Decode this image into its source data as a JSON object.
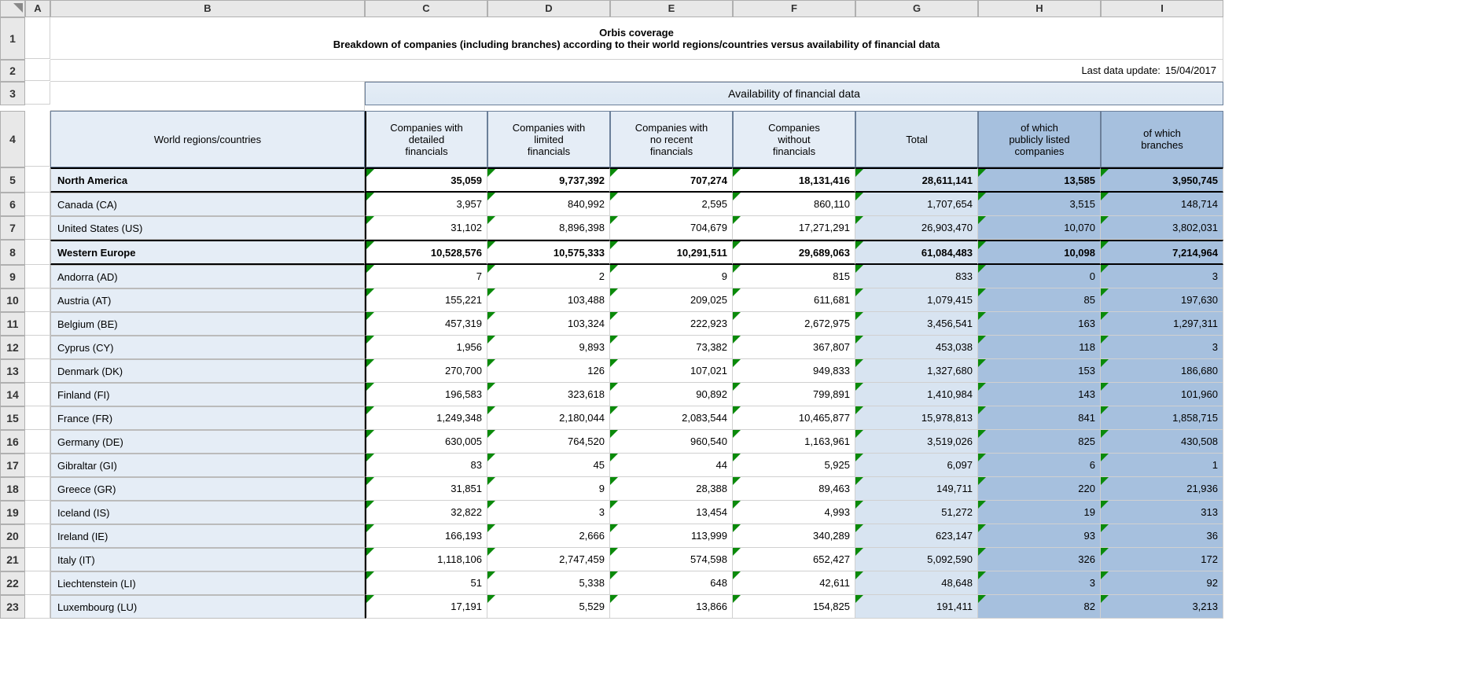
{
  "columns": [
    "A",
    "B",
    "C",
    "D",
    "E",
    "F",
    "G",
    "H",
    "I"
  ],
  "title1": "Orbis coverage",
  "title2": "Breakdown of companies (including branches) according to their world regions/countries versus availability of financial data",
  "lastUpdateLabel": "Last data update:",
  "lastUpdateValue": "15/04/2017",
  "availabilityHeader": "Availability of financial data",
  "colHeaders": {
    "b": "World regions/countries",
    "c": "Companies with\ndetailed\nfinancials",
    "d": "Companies with\nlimited\nfinancials",
    "e": "Companies with\nno recent\nfinancials",
    "f": "Companies\nwithout\nfinancials",
    "g": "Total",
    "h": "of which\npublicly listed\ncompanies",
    "i": "of which\nbranches"
  },
  "rows": [
    {
      "n": 5,
      "region": true,
      "label": "North America",
      "v": [
        "35,059",
        "9,737,392",
        "707,274",
        "18,131,416",
        "28,611,141",
        "13,585",
        "3,950,745"
      ]
    },
    {
      "n": 6,
      "label": "Canada (CA)",
      "v": [
        "3,957",
        "840,992",
        "2,595",
        "860,110",
        "1,707,654",
        "3,515",
        "148,714"
      ]
    },
    {
      "n": 7,
      "label": "United States (US)",
      "v": [
        "31,102",
        "8,896,398",
        "704,679",
        "17,271,291",
        "26,903,470",
        "10,070",
        "3,802,031"
      ]
    },
    {
      "n": 8,
      "region": true,
      "label": "Western Europe",
      "v": [
        "10,528,576",
        "10,575,333",
        "10,291,511",
        "29,689,063",
        "61,084,483",
        "10,098",
        "7,214,964"
      ]
    },
    {
      "n": 9,
      "label": "Andorra (AD)",
      "v": [
        "7",
        "2",
        "9",
        "815",
        "833",
        "0",
        "3"
      ]
    },
    {
      "n": 10,
      "label": "Austria (AT)",
      "v": [
        "155,221",
        "103,488",
        "209,025",
        "611,681",
        "1,079,415",
        "85",
        "197,630"
      ]
    },
    {
      "n": 11,
      "label": "Belgium (BE)",
      "v": [
        "457,319",
        "103,324",
        "222,923",
        "2,672,975",
        "3,456,541",
        "163",
        "1,297,311"
      ]
    },
    {
      "n": 12,
      "label": "Cyprus (CY)",
      "v": [
        "1,956",
        "9,893",
        "73,382",
        "367,807",
        "453,038",
        "118",
        "3"
      ]
    },
    {
      "n": 13,
      "label": "Denmark (DK)",
      "v": [
        "270,700",
        "126",
        "107,021",
        "949,833",
        "1,327,680",
        "153",
        "186,680"
      ]
    },
    {
      "n": 14,
      "label": "Finland (FI)",
      "v": [
        "196,583",
        "323,618",
        "90,892",
        "799,891",
        "1,410,984",
        "143",
        "101,960"
      ]
    },
    {
      "n": 15,
      "label": "France (FR)",
      "v": [
        "1,249,348",
        "2,180,044",
        "2,083,544",
        "10,465,877",
        "15,978,813",
        "841",
        "1,858,715"
      ]
    },
    {
      "n": 16,
      "label": "Germany (DE)",
      "v": [
        "630,005",
        "764,520",
        "960,540",
        "1,163,961",
        "3,519,026",
        "825",
        "430,508"
      ]
    },
    {
      "n": 17,
      "label": "Gibraltar (GI)",
      "v": [
        "83",
        "45",
        "44",
        "5,925",
        "6,097",
        "6",
        "1"
      ]
    },
    {
      "n": 18,
      "label": "Greece (GR)",
      "v": [
        "31,851",
        "9",
        "28,388",
        "89,463",
        "149,711",
        "220",
        "21,936"
      ]
    },
    {
      "n": 19,
      "label": "Iceland (IS)",
      "v": [
        "32,822",
        "3",
        "13,454",
        "4,993",
        "51,272",
        "19",
        "313"
      ]
    },
    {
      "n": 20,
      "label": "Ireland (IE)",
      "v": [
        "166,193",
        "2,666",
        "113,999",
        "340,289",
        "623,147",
        "93",
        "36"
      ]
    },
    {
      "n": 21,
      "label": "Italy (IT)",
      "v": [
        "1,118,106",
        "2,747,459",
        "574,598",
        "652,427",
        "5,092,590",
        "326",
        "172"
      ]
    },
    {
      "n": 22,
      "label": "Liechtenstein (LI)",
      "v": [
        "51",
        "5,338",
        "648",
        "42,611",
        "48,648",
        "3",
        "92"
      ]
    },
    {
      "n": 23,
      "label": "Luxembourg (LU)",
      "v": [
        "17,191",
        "5,529",
        "13,866",
        "154,825",
        "191,411",
        "82",
        "3,213"
      ]
    }
  ]
}
